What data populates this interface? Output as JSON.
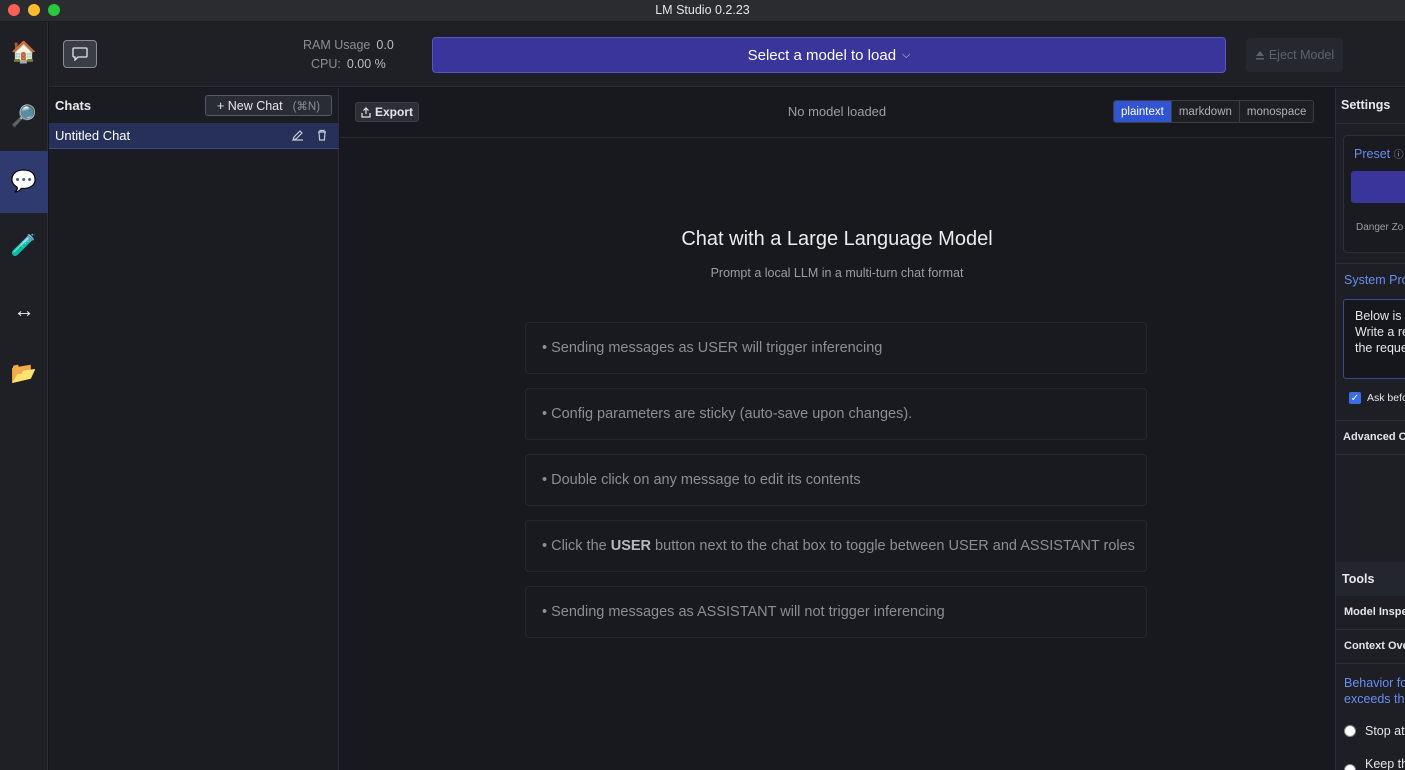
{
  "window": {
    "title": "LM Studio 0.2.23"
  },
  "nav": [
    {
      "name": "home-icon",
      "glyph": "🏠"
    },
    {
      "name": "search-icon",
      "glyph": "🔎"
    },
    {
      "name": "chat-icon",
      "glyph": "💬"
    },
    {
      "name": "playground-icon",
      "glyph": "🧪"
    },
    {
      "name": "server-icon",
      "glyph": "↔"
    },
    {
      "name": "folder-icon",
      "glyph": "📂"
    }
  ],
  "topbar": {
    "ram_label": "RAM Usage",
    "ram_value": "0.0",
    "cpu_label": "CPU:",
    "cpu_value": "0.00 %",
    "model_select_label": "Select a model to load",
    "eject_label": "Eject Model"
  },
  "chats": {
    "title": "Chats",
    "new_chat_label": "+ New Chat",
    "new_chat_shortcut": "(⌘N)",
    "items": [
      {
        "name": "Untitled Chat"
      }
    ]
  },
  "main": {
    "export_label": "Export",
    "status": "No model loaded",
    "formats": [
      "plaintext",
      "markdown",
      "monospace"
    ],
    "active_format": "plaintext",
    "hero_title": "Chat with a Large Language Model",
    "hero_subtitle": "Prompt a local LLM in a multi-turn chat format",
    "tips": [
      {
        "text": "• Sending messages as USER will trigger inferencing"
      },
      {
        "text": "• Config parameters are sticky (auto-save upon changes)."
      },
      {
        "text": "• Double click on any message to edit its contents"
      },
      {
        "before": "• Click the ",
        "bold": "USER",
        "after": " button next to the chat box to toggle between USER and ASSISTANT roles"
      },
      {
        "text": "• Sending messages as ASSISTANT will not trigger inferencing"
      }
    ]
  },
  "settings": {
    "title": "Settings",
    "preset_label": "Preset",
    "danger_label": "Danger Zo",
    "system_prompt_label": "System Pro",
    "system_prompt_lines": [
      "Below is a",
      "Write a re",
      "the reque"
    ],
    "ask_label": "Ask befo",
    "advanced_label": "Advanced C",
    "tools_title": "Tools",
    "tool_items": [
      "Model Inspe",
      "Context Ove"
    ],
    "behavior_lines": [
      "Behavior fo",
      "exceeds th"
    ],
    "radio_options": [
      "Stop at",
      "Keep th"
    ]
  }
}
